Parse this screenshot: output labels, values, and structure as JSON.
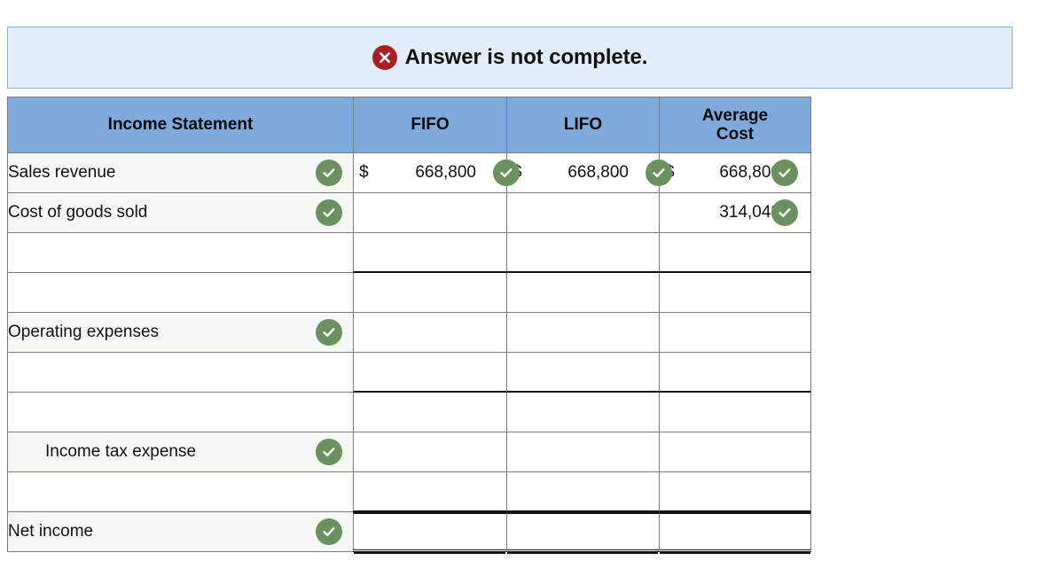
{
  "alert": {
    "icon": "x-circle-icon",
    "message": "Answer is not complete.",
    "background_color": "#e2edf8",
    "border_color": "#8cb0dc",
    "icon_color": "#a91f23"
  },
  "table": {
    "header_background": "#80a9dc",
    "check_color": "#6b9161",
    "columns": [
      {
        "key": "label",
        "label": "Income Statement"
      },
      {
        "key": "fifo",
        "label": "FIFO"
      },
      {
        "key": "lifo",
        "label": "LIFO"
      },
      {
        "key": "avg",
        "label": "Average\nCost"
      }
    ],
    "header": {
      "label": "Income Statement",
      "fifo": "FIFO",
      "lifo": "LIFO",
      "avg_line1": "Average",
      "avg_line2": "Cost"
    },
    "rows": [
      {
        "label": "Sales revenue",
        "label_checked": true,
        "indent": false,
        "fifo": {
          "currency": "$",
          "value": "668,800",
          "checked": true
        },
        "lifo": {
          "currency": "$",
          "value": "668,800",
          "checked": true
        },
        "avg": {
          "currency": "$",
          "value": "668,800",
          "checked": true
        },
        "rule": "none"
      },
      {
        "label": "Cost of goods sold",
        "label_checked": true,
        "indent": false,
        "fifo": {
          "currency": "",
          "value": "",
          "checked": false
        },
        "lifo": {
          "currency": "",
          "value": "",
          "checked": false
        },
        "avg": {
          "currency": "",
          "value": "314,048",
          "checked": true
        },
        "rule": "none"
      },
      {
        "label": "",
        "label_checked": false,
        "indent": false,
        "fifo": {
          "currency": "",
          "value": "",
          "checked": false
        },
        "lifo": {
          "currency": "",
          "value": "",
          "checked": false
        },
        "avg": {
          "currency": "",
          "value": "",
          "checked": false
        },
        "rule": "under"
      },
      {
        "label": "",
        "label_checked": false,
        "indent": false,
        "fifo": {
          "currency": "",
          "value": "",
          "checked": false
        },
        "lifo": {
          "currency": "",
          "value": "",
          "checked": false
        },
        "avg": {
          "currency": "",
          "value": "",
          "checked": false
        },
        "rule": "none"
      },
      {
        "label": "Operating expenses",
        "label_checked": true,
        "indent": false,
        "fifo": {
          "currency": "",
          "value": "",
          "checked": false
        },
        "lifo": {
          "currency": "",
          "value": "",
          "checked": false
        },
        "avg": {
          "currency": "",
          "value": "",
          "checked": false
        },
        "rule": "none"
      },
      {
        "label": "",
        "label_checked": false,
        "indent": false,
        "fifo": {
          "currency": "",
          "value": "",
          "checked": false
        },
        "lifo": {
          "currency": "",
          "value": "",
          "checked": false
        },
        "avg": {
          "currency": "",
          "value": "",
          "checked": false
        },
        "rule": "under"
      },
      {
        "label": "",
        "label_checked": false,
        "indent": false,
        "fifo": {
          "currency": "",
          "value": "",
          "checked": false
        },
        "lifo": {
          "currency": "",
          "value": "",
          "checked": false
        },
        "avg": {
          "currency": "",
          "value": "",
          "checked": false
        },
        "rule": "none"
      },
      {
        "label": "Income tax expense",
        "label_checked": true,
        "indent": true,
        "fifo": {
          "currency": "",
          "value": "",
          "checked": false
        },
        "lifo": {
          "currency": "",
          "value": "",
          "checked": false
        },
        "avg": {
          "currency": "",
          "value": "",
          "checked": false
        },
        "rule": "none"
      },
      {
        "label": "",
        "label_checked": false,
        "indent": false,
        "fifo": {
          "currency": "",
          "value": "",
          "checked": false
        },
        "lifo": {
          "currency": "",
          "value": "",
          "checked": false
        },
        "avg": {
          "currency": "",
          "value": "",
          "checked": false
        },
        "rule": "under"
      },
      {
        "label": "Net income",
        "label_checked": true,
        "indent": false,
        "fifo": {
          "currency": "",
          "value": "",
          "checked": false
        },
        "lifo": {
          "currency": "",
          "value": "",
          "checked": false
        },
        "avg": {
          "currency": "",
          "value": "",
          "checked": false
        },
        "rule": "double-under"
      }
    ]
  }
}
